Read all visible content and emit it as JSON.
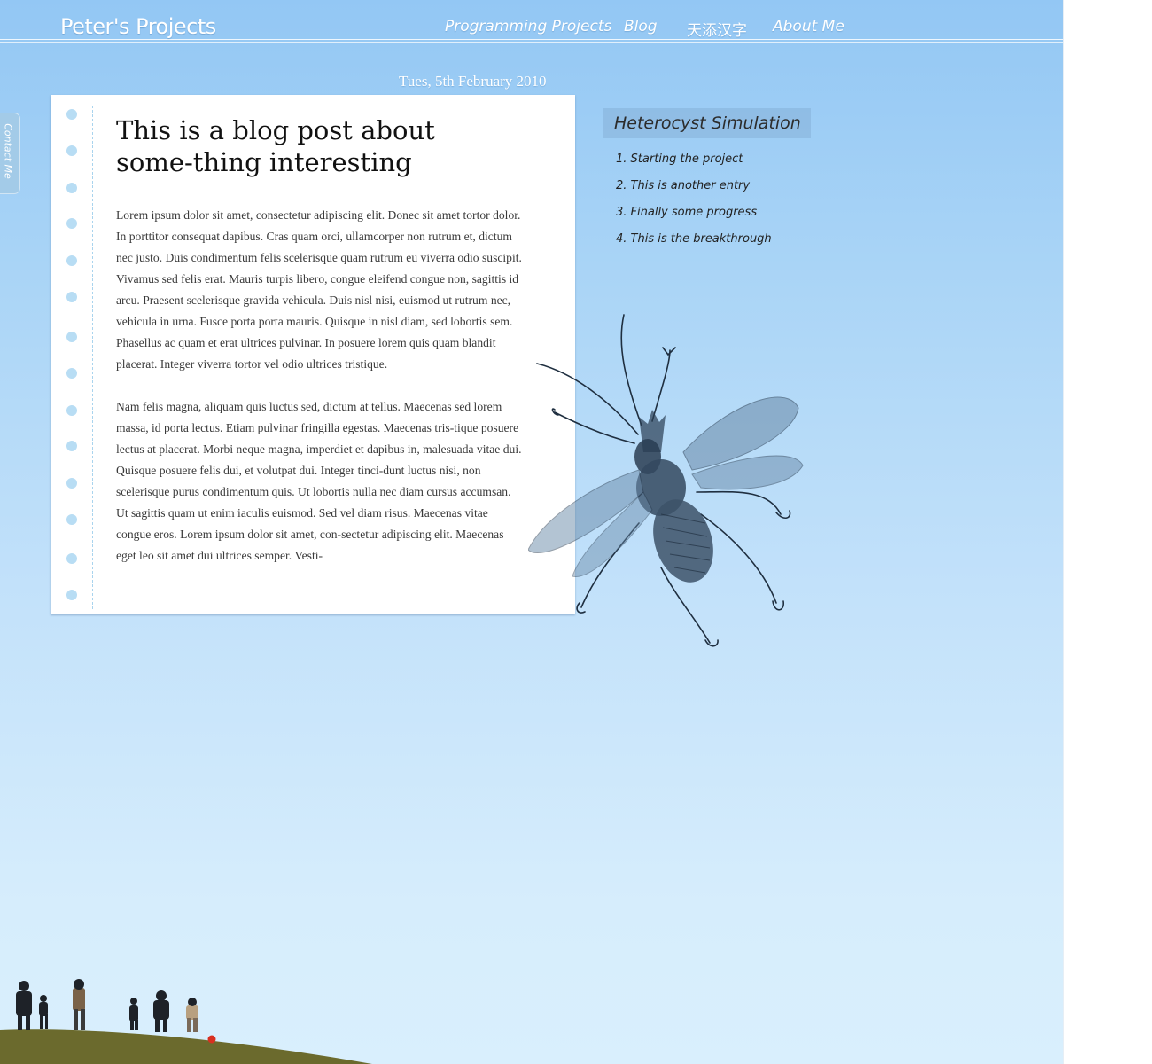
{
  "site": {
    "logo": "Peter's Projects"
  },
  "nav": {
    "items": [
      {
        "label": "Programming Projects"
      },
      {
        "label": "Blog"
      },
      {
        "label": "天添汉字"
      },
      {
        "label": "About Me"
      }
    ]
  },
  "contact_tab": {
    "label": "Contact Me"
  },
  "post": {
    "date": "Tues, 5th February 2010",
    "title": "This is a blog post about some-thing interesting",
    "paragraphs": [
      "Lorem ipsum dolor sit amet, consectetur adipiscing elit. Donec sit amet tortor dolor. In porttitor consequat dapibus. Cras quam orci, ullamcorper non rutrum et, dictum nec justo. Duis condimentum felis scelerisque quam rutrum eu viverra odio suscipit. Vivamus sed felis erat. Mauris turpis libero, congue eleifend congue non, sagittis id arcu. Praesent scelerisque gravida vehicula. Duis nisl nisi, euismod ut rutrum nec, vehicula in urna. Fusce porta porta mauris. Quisque in nisl diam, sed lobortis sem. Phasellus ac quam et erat ultrices pulvinar. In posuere lorem quis quam blandit placerat. Integer viverra tortor vel odio ultrices tristique.",
      "Nam felis magna, aliquam quis luctus sed, dictum at tellus. Maecenas sed lorem massa, id porta lectus. Etiam pulvinar fringilla egestas. Maecenas tris-tique posuere lectus at placerat. Morbi neque magna, imperdiet et dapibus in, malesuada vitae dui. Quisque posuere felis dui, et volutpat dui. Integer tinci-dunt luctus nisi, non scelerisque purus condimentum quis. Ut lobortis nulla nec diam cursus accumsan. Ut sagittis quam ut enim iaculis euismod. Sed vel diam risus. Maecenas vitae congue eros. Lorem ipsum dolor sit amet, con-sectetur adipiscing elit. Maecenas eget leo sit amet dui ultrices semper. Vesti-"
    ]
  },
  "sidebar": {
    "title": "Heterocyst Simulation",
    "entries": [
      {
        "label": "1. Starting the project"
      },
      {
        "label": "2. This is another entry"
      },
      {
        "label": "3. Finally some progress"
      },
      {
        "label": "4. This is the breakthrough"
      }
    ]
  },
  "colors": {
    "sky_top": "#93c7f4",
    "sky_bottom": "#d9effd",
    "hole": "#b8ddf4",
    "sidebar_header": "#a3bfd9"
  }
}
